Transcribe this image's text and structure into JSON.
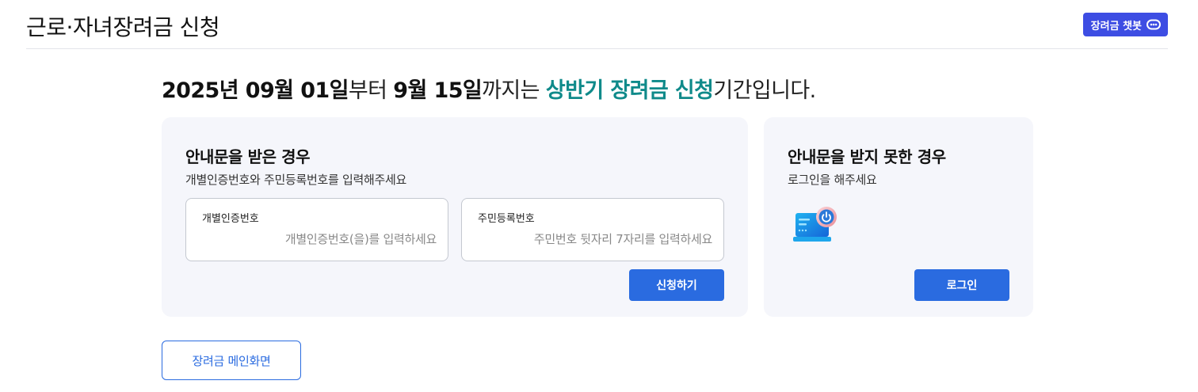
{
  "header": {
    "title": "근로·자녀장려금 신청",
    "chatbot_label": "장려금 챗봇"
  },
  "period": {
    "start": "2025년 09월 01일",
    "from": "부터 ",
    "end": "9월 15일",
    "until": "까지는 ",
    "highlight": "상반기 장려금 신청",
    "suffix": "기간입니다."
  },
  "notice_received": {
    "title": "안내문을 받은 경우",
    "description": "개별인증번호와 주민등록번호를 입력해주세요",
    "auth_field": {
      "label": "개별인증번호",
      "value": "",
      "placeholder": "개별인증번호(을)를 입력하세요"
    },
    "rrn_field": {
      "label": "주민등록번호",
      "value": "",
      "placeholder": "주민번호 뒷자리 7자리를 입력하세요"
    },
    "apply_label": "신청하기"
  },
  "notice_not_received": {
    "title": "안내문을 받지 못한 경우",
    "description": "로그인을 해주세요",
    "illustration_icon": "laptop-power-icon",
    "login_label": "로그인"
  },
  "footer": {
    "main_label": "장려금 메인화면"
  },
  "colors": {
    "primary": "#2a6be0",
    "chatbot": "#3d4de3",
    "highlight": "#0f8a8a",
    "card_bg": "#f5f6fb"
  }
}
